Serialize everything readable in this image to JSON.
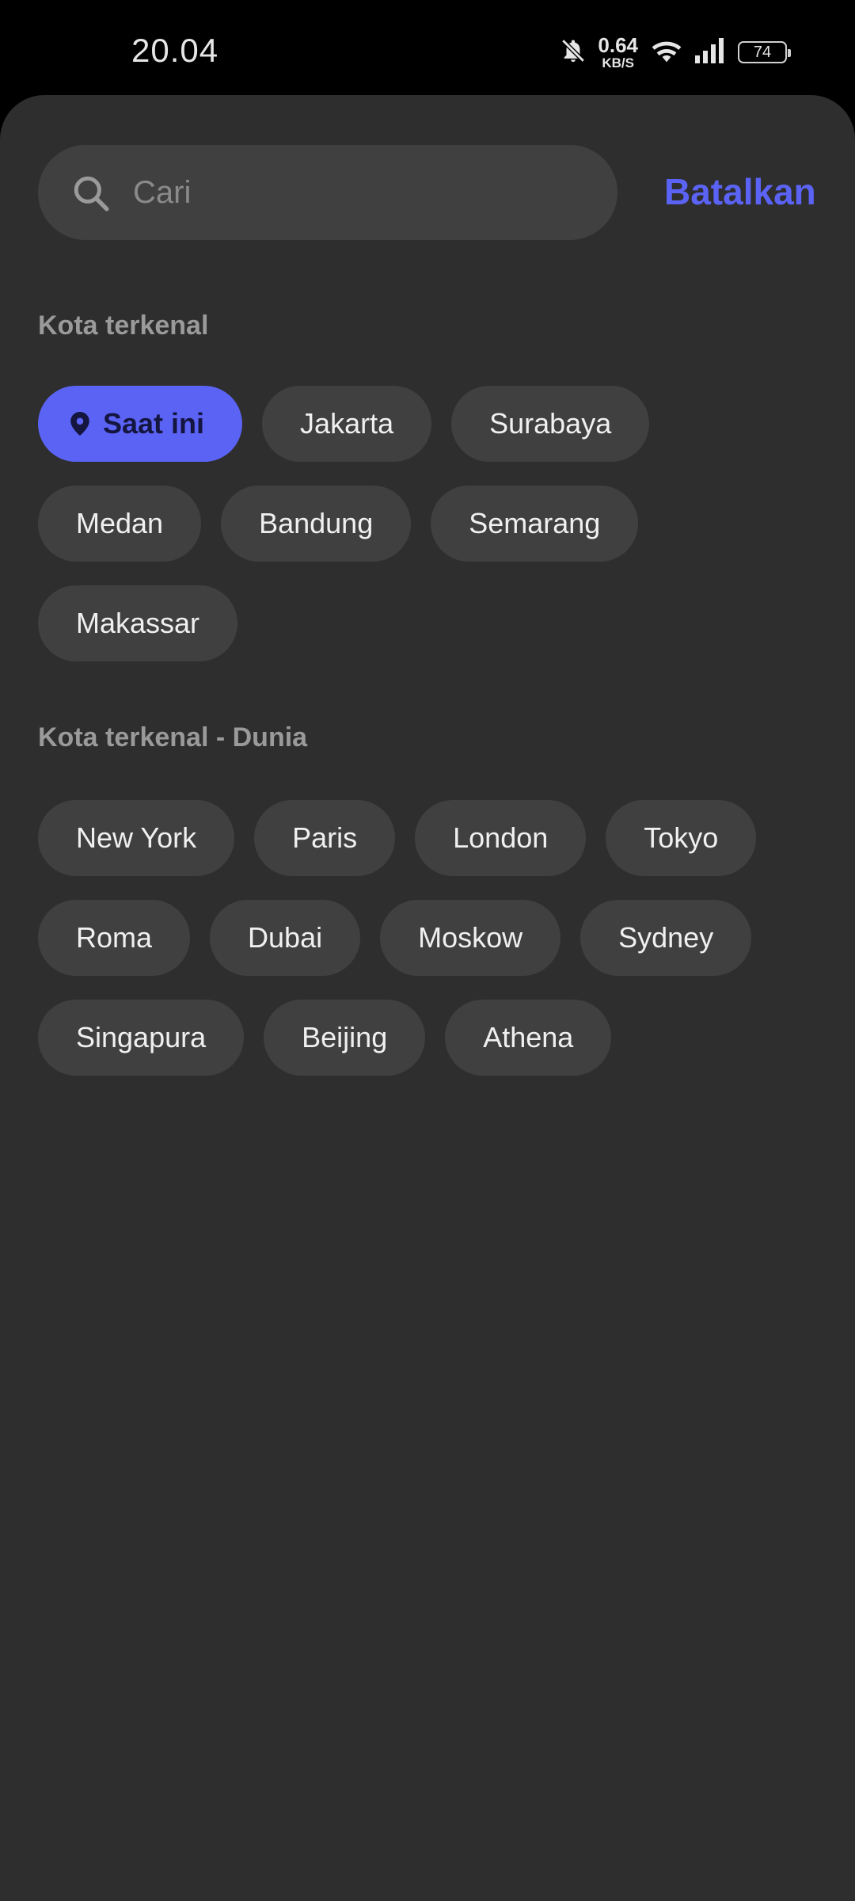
{
  "status_bar": {
    "time": "20.04",
    "net_speed_value": "0.64",
    "net_speed_unit": "KB/S",
    "battery": "74",
    "icons": [
      "bell-muted-icon",
      "wifi-icon",
      "signal-icon",
      "battery-icon"
    ]
  },
  "search": {
    "placeholder": "Cari",
    "value": "",
    "cancel_label": "Batalkan"
  },
  "popular_cities": {
    "title": "Kota terkenal",
    "current_label": "Saat ini",
    "cities": [
      "Jakarta",
      "Surabaya",
      "Medan",
      "Bandung",
      "Semarang",
      "Makassar"
    ]
  },
  "world_cities": {
    "title": "Kota terkenal - Dunia",
    "cities": [
      "New York",
      "Paris",
      "London",
      "Tokyo",
      "Roma",
      "Dubai",
      "Moskow",
      "Sydney",
      "Singapura",
      "Beijing",
      "Athena"
    ]
  },
  "colors": {
    "accent": "#5b63f5",
    "background": "#2e2e2e",
    "chip": "#404040"
  }
}
